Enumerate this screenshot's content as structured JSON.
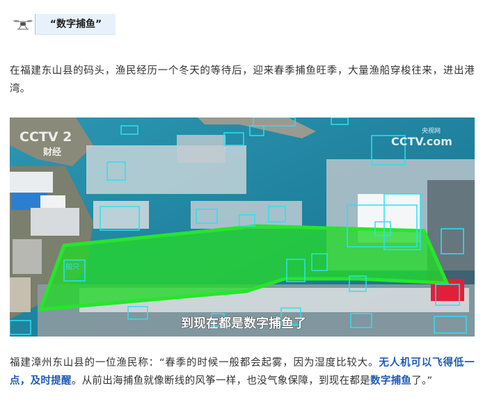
{
  "heading": {
    "title": "“数字捕鱼”"
  },
  "intro": {
    "text": "在福建东山县的码头，渔民经历一个冬天的等待后，迎来春季捕鱼旺季，大量渔船穿梭往来，进出港湾。"
  },
  "photo": {
    "channel_logo": "CCTV 2",
    "channel_name": "财经",
    "watermark_top": "央视网",
    "watermark_logo": "CCTV.com",
    "overlay_label": "船只",
    "subtitle": "到现在都是数字捕鱼了"
  },
  "quote": {
    "part1": "福建漳州东山县的一位渔民称：“春季的时候一般都会起雾，因为湿度比较大。",
    "highlight1": "无人机可以飞得低一点，及时提醒",
    "part2": "。从前出海捕鱼就像断线的风筝一样，也没气象保障，到现在都是",
    "highlight2": "数字捕鱼",
    "part3": "了。”"
  },
  "colors": {
    "highlight": "#1f5bb5",
    "detection_box": "#2ee0f0",
    "zone": "#22e22a",
    "sea": "#1c8aa8"
  }
}
